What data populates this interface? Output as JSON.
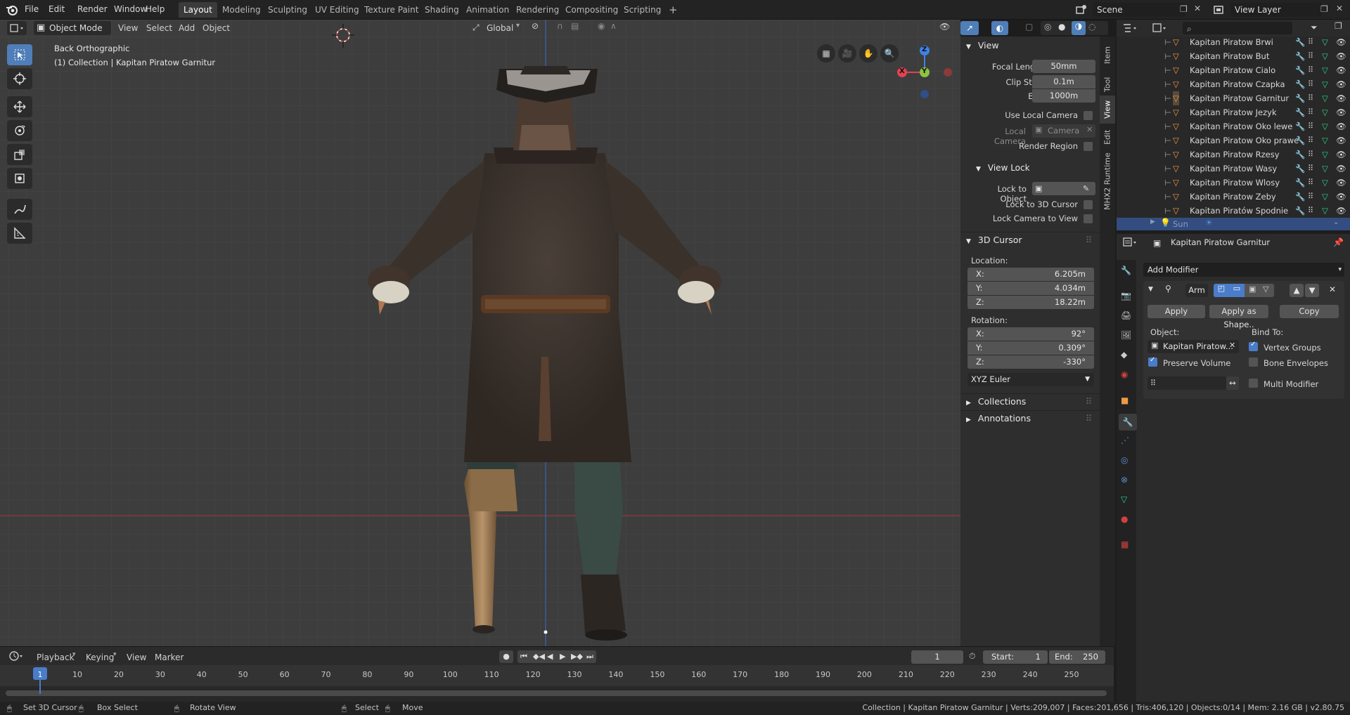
{
  "topbar": {
    "menus": [
      "File",
      "Edit",
      "Render",
      "Window",
      "Help"
    ],
    "workspaces": [
      "Layout",
      "Modeling",
      "Sculpting",
      "UV Editing",
      "Texture Paint",
      "Shading",
      "Animation",
      "Rendering",
      "Compositing",
      "Scripting"
    ],
    "active_workspace": "Layout",
    "add_tab": "+",
    "scene": "Scene",
    "view_layer": "View Layer"
  },
  "viewport": {
    "mode": "Object Mode",
    "menus": [
      "View",
      "Select",
      "Add",
      "Object"
    ],
    "orientation": "Global",
    "view_name": "Back Orthographic",
    "collection_info": "(1) Collection | Kapitan Piratow Garnitur",
    "gizmo_axes": [
      "X",
      "Y",
      "Z"
    ]
  },
  "npanel": {
    "tabs": [
      "Item",
      "Tool",
      "View",
      "Edit",
      "MHX2 Runtime"
    ],
    "active_tab": "View",
    "view": {
      "title": "View",
      "focal_length_label": "Focal Length",
      "focal_length": "50mm",
      "clip_start_label": "Clip Start",
      "clip_start": "0.1m",
      "clip_end_label": "End",
      "clip_end": "1000m",
      "use_local_camera": "Use Local Camera",
      "local_camera_label": "Local Camera",
      "local_camera_value": "Camera",
      "render_region": "Render Region"
    },
    "view_lock": {
      "title": "View Lock",
      "lock_to_object": "Lock to Object",
      "lock_3d_cursor": "Lock to 3D Cursor",
      "lock_camera": "Lock Camera to View"
    },
    "cursor": {
      "title": "3D Cursor",
      "location_label": "Location:",
      "loc_x_label": "X:",
      "loc_x": "6.205m",
      "loc_y_label": "Y:",
      "loc_y": "4.034m",
      "loc_z_label": "Z:",
      "loc_z": "18.22m",
      "rotation_label": "Rotation:",
      "rot_x_label": "X:",
      "rot_x": "92°",
      "rot_y_label": "Y:",
      "rot_y": "0.309°",
      "rot_z_label": "Z:",
      "rot_z": "-330°",
      "rotation_mode": "XYZ Euler"
    },
    "collections": "Collections",
    "annotations": "Annotations"
  },
  "outliner": {
    "search_placeholder": "",
    "items": [
      "Kapitan Piratow Brwi",
      "Kapitan Piratow But",
      "Kapitan Piratow Cialo",
      "Kapitan Piratow Czapka",
      "Kapitan Piratow Garnitur",
      "Kapitan Piratow Jezyk",
      "Kapitan Piratow Oko lewe",
      "Kapitan Piratow Oko prawe",
      "Kapitan Piratow Rzesy",
      "Kapitan Piratow Wasy",
      "Kapitan Piratow Wlosy",
      "Kapitan Piratow Zeby",
      "Kapitan Piratów Spodnie"
    ],
    "selected_item": "Sun"
  },
  "properties": {
    "object_name": "Kapitan Piratow Garnitur",
    "add_modifier": "Add Modifier",
    "modifier_name": "Arm",
    "apply": "Apply",
    "apply_as_shape": "Apply as Shape..",
    "copy": "Copy",
    "object_label": "Object:",
    "object_value": "Kapitan Piratow...",
    "bind_to": "Bind To:",
    "vertex_groups": "Vertex Groups",
    "preserve_volume": "Preserve Volume",
    "bone_envelopes": "Bone Envelopes",
    "multi_modifier": "Multi Modifier"
  },
  "timeline": {
    "menus": [
      "Playback",
      "Keying",
      "View",
      "Marker"
    ],
    "current_frame": "1",
    "start_label": "Start:",
    "start": "1",
    "end_label": "End:",
    "end": "250",
    "ticks": [
      "1",
      "10",
      "20",
      "30",
      "40",
      "50",
      "60",
      "70",
      "80",
      "90",
      "100",
      "110",
      "120",
      "130",
      "140",
      "150",
      "160",
      "170",
      "180",
      "190",
      "200",
      "210",
      "220",
      "230",
      "240",
      "250"
    ]
  },
  "statusbar": {
    "set_cursor": "Set 3D Cursor",
    "box_select": "Box Select",
    "rotate_view": "Rotate View",
    "select": "Select",
    "move": "Move",
    "stats": "Collection | Kapitan Piratow Garnitur | Verts:209,007 | Faces:201,656 | Tris:406,120 | Objects:0/14 | Mem: 2.16 GB | v2.80.75"
  },
  "colors": {
    "accent": "#4a7cc9",
    "selection": "#334d80",
    "x_axis": "#e0424f",
    "y_axis": "#8bc53f",
    "z_axis": "#3f82e8",
    "object_orange": "#f09a45",
    "mesh_green": "#2ccf86"
  }
}
